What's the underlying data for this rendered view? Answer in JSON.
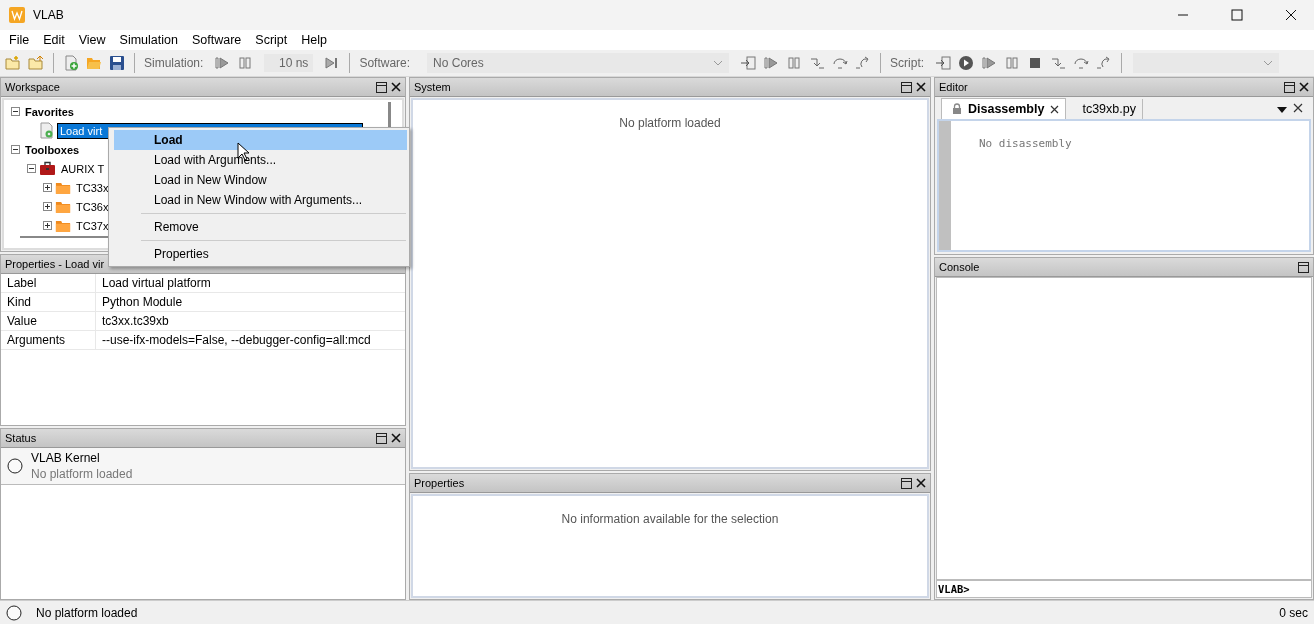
{
  "window": {
    "title": "VLAB"
  },
  "menu": [
    "File",
    "Edit",
    "View",
    "Simulation",
    "Software",
    "Script",
    "Help"
  ],
  "toolbar": {
    "simulation_label": "Simulation:",
    "time": "10 ns",
    "software_label": "Software:",
    "cores": "No Cores",
    "script_label": "Script:"
  },
  "workspace": {
    "title": "Workspace",
    "closable": true,
    "tree": [
      {
        "label": "Favorites",
        "kind": "group",
        "expanded": true,
        "selected": false,
        "children": [
          {
            "label": "Load virt",
            "kind": "script",
            "selected": true
          }
        ]
      },
      {
        "label": "Toolboxes",
        "kind": "group",
        "expanded": true,
        "selected": false,
        "children": [
          {
            "label": "AURIX T",
            "kind": "toolbox",
            "expanded": true,
            "selected": false,
            "children": [
              {
                "label": "TC33x",
                "kind": "folder",
                "expanded": false,
                "selected": false
              },
              {
                "label": "TC36x",
                "kind": "folder",
                "expanded": false,
                "selected": false
              },
              {
                "label": "TC37x",
                "kind": "folder",
                "expanded": false,
                "selected": false
              }
            ]
          }
        ]
      }
    ]
  },
  "context_menu": [
    {
      "kind": "item",
      "label": "Load",
      "default": true,
      "selected": true
    },
    {
      "kind": "item",
      "label": "Load with Arguments...",
      "default": false,
      "selected": false
    },
    {
      "kind": "item",
      "label": "Load in New Window",
      "default": false,
      "selected": false
    },
    {
      "kind": "item",
      "label": "Load in New Window with Arguments...",
      "default": false,
      "selected": false
    },
    {
      "kind": "separator"
    },
    {
      "kind": "item",
      "label": "Remove",
      "default": false,
      "selected": false
    },
    {
      "kind": "separator"
    },
    {
      "kind": "item",
      "label": "Properties",
      "default": false,
      "selected": false
    }
  ],
  "item_properties": {
    "title": "Properties - Load vir",
    "rows": [
      {
        "name": "Label",
        "value": "Load virtual platform"
      },
      {
        "name": "Kind",
        "value": "Python Module"
      },
      {
        "name": "Value",
        "value": "tc3xx.tc39xb"
      },
      {
        "name": "Arguments",
        "value": "--use-ifx-models=False, --debugger-config=all:mcd"
      }
    ]
  },
  "status": {
    "title": "Status",
    "closable": true,
    "items": [
      {
        "name": "VLAB Kernel",
        "detail": "No platform loaded"
      }
    ]
  },
  "system": {
    "title": "System",
    "closable": true,
    "message": "No platform loaded"
  },
  "properties": {
    "title": "Properties",
    "closable": true,
    "message": "No information available for the selection"
  },
  "editor": {
    "title": "Editor",
    "closable": true,
    "tabs": [
      {
        "label": "Disassembly",
        "selected": true,
        "locked": true
      },
      {
        "label": "tc39xb.py",
        "selected": false,
        "locked": false
      }
    ],
    "content": "No disassembly"
  },
  "console": {
    "title": "Console",
    "closable": false,
    "prompt": "VLAB>"
  },
  "status_bar": {
    "message": "No platform loaded",
    "time": "0 sec"
  }
}
